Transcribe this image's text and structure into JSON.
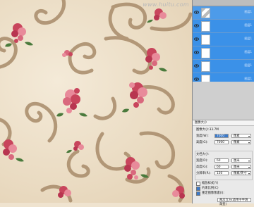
{
  "watermark": "www.huitu.com",
  "layers": {
    "names": [
      "图层1",
      "图层1",
      "图层1",
      "图层1",
      "图层1",
      "图层1"
    ]
  },
  "dialog": {
    "title": "图像大小",
    "image_size_label": "图像大小:33.7M",
    "width_label": "宽度(W):",
    "width_value": "7000",
    "height_label": "高度(G):",
    "height_value": "7000",
    "pixel_unit": "像素",
    "doc_size_label": "文档大小:",
    "doc_width_label": "宽度(D):",
    "doc_width_value": "60",
    "doc_height_label": "高度(G):",
    "doc_height_value": "60",
    "resolution_label": "分辨率(R):",
    "resolution_value": "130",
    "cm_unit": "厘米",
    "ppi_unit": "像素/英寸",
    "scale_styles": "缩放样式(Y)",
    "constrain": "约束比例(C)",
    "resample": "重定图像像素(I):",
    "resample_method": "两次立方(适用于平滑渐变)"
  },
  "colors": {
    "canvas_bg": "#efe3cf",
    "scroll": "#a88b6a",
    "flower": "#c8455c",
    "flower_light": "#e88a9a",
    "leaf": "#4a7a3c",
    "layer_selected": "#3b91e8"
  }
}
